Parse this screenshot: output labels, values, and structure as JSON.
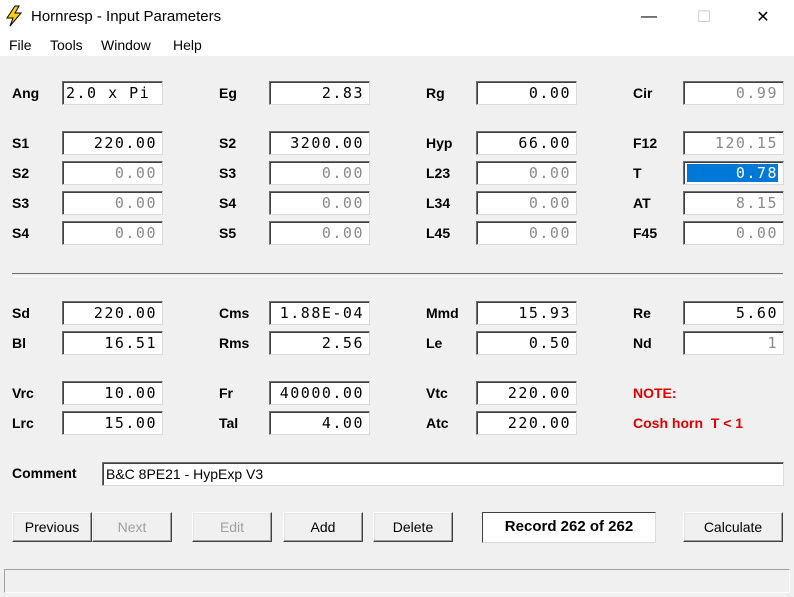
{
  "window": {
    "title": "Hornresp - Input Parameters",
    "minimize": "—",
    "maximize": "☐",
    "close": "✕"
  },
  "menu": [
    "File",
    "Tools",
    "Window",
    "Help"
  ],
  "params": {
    "Ang": "2.0 x Pi",
    "Eg": "2.83",
    "Rg": "0.00",
    "Cir": "0.99",
    "S1": "220.00",
    "S2": "3200.00",
    "Hyp": "66.00",
    "F12": "120.15",
    "S2b": "0.00",
    "S3": "0.00",
    "L23": "0.00",
    "T": "0.78",
    "S3b": "0.00",
    "S4": "0.00",
    "L34": "0.00",
    "AT": "8.15",
    "S4b": "0.00",
    "S5": "0.00",
    "L45": "0.00",
    "F45": "0.00",
    "Sd": "220.00",
    "Cms": "1.88E-04",
    "Mmd": "15.93",
    "Re": "5.60",
    "Bl": "16.51",
    "Rms": "2.56",
    "Le": "0.50",
    "Nd": "1",
    "Vrc": "10.00",
    "Fr": "40000.00",
    "Vtc": "220.00",
    "Lrc": "15.00",
    "Tal": "4.00",
    "Atc": "220.00"
  },
  "labels": {
    "Ang": "Ang",
    "Eg": "Eg",
    "Rg": "Rg",
    "Cir": "Cir",
    "S1": "S1",
    "S2": "S2",
    "Hyp": "Hyp",
    "F12": "F12",
    "S2b": "S2",
    "S3": "S3",
    "L23": "L23",
    "T": "T",
    "S3b": "S3",
    "S4": "S4",
    "L34": "L34",
    "AT": "AT",
    "S4b": "S4",
    "S5": "S5",
    "L45": "L45",
    "F45": "F45",
    "Sd": "Sd",
    "Cms": "Cms",
    "Mmd": "Mmd",
    "Re": "Re",
    "Bl": "Bl",
    "Rms": "Rms",
    "Le": "Le",
    "Nd": "Nd",
    "Vrc": "Vrc",
    "Fr": "Fr",
    "Vtc": "Vtc",
    "Lrc": "Lrc",
    "Tal": "Tal",
    "Atc": "Atc",
    "Comment": "Comment"
  },
  "note": {
    "title": "NOTE:",
    "text": "Cosh horn  T < 1"
  },
  "comment": "B&C 8PE21 - HypExp V3",
  "buttons": {
    "previous": "Previous",
    "next": "Next",
    "edit": "Edit",
    "add": "Add",
    "delete": "Delete",
    "calculate": "Calculate"
  },
  "record": "Record 262 of 262",
  "colors": {
    "selection": "#0078d7",
    "note": "#e00000",
    "disabled_text": "#8a8a8a"
  }
}
